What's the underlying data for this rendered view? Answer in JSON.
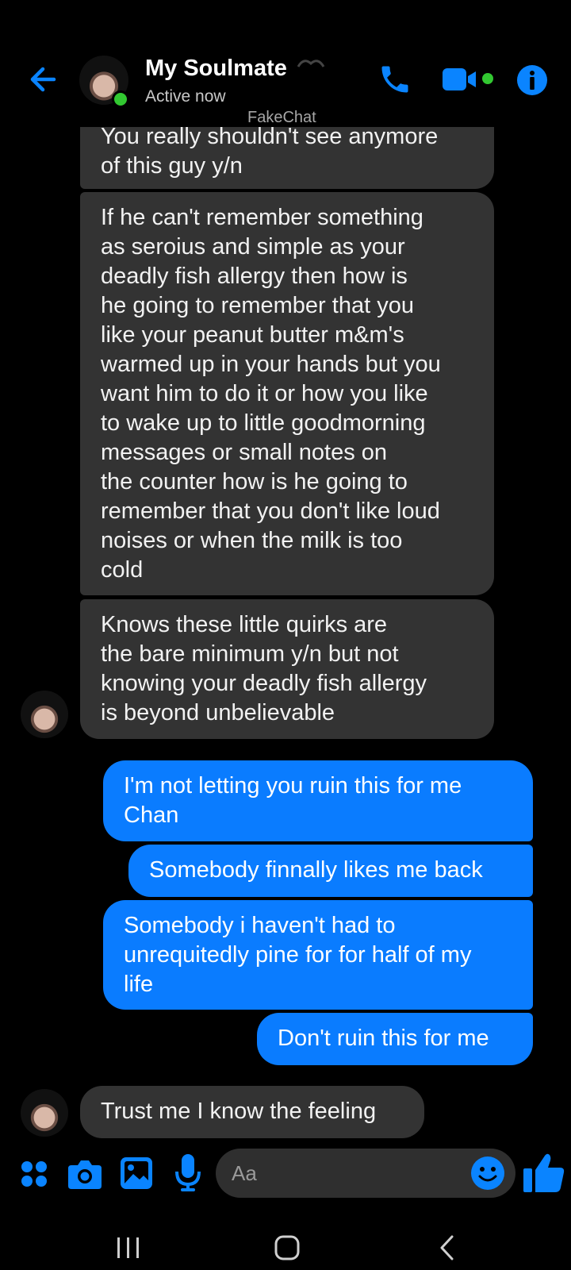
{
  "header": {
    "title": "My Soulmate",
    "status": "Active now",
    "watermark": "FakeChat"
  },
  "messages": [
    {
      "side": "in",
      "text": "You really shouldn't see anymore\nof this guy y/n"
    },
    {
      "side": "in",
      "text": "If he can't remember something\nas seroius and simple as your\ndeadly fish allergy then how is\nhe going to remember that you\nlike your peanut butter m&m's\nwarmed up in your hands but you\nwant him to do it or how you like\nto wake up to little goodmorning\nmessages or small notes on\nthe counter how is he going to\nremember that you don't like loud\nnoises or when the milk is too\ncold"
    },
    {
      "side": "in",
      "text": "Knows these little quirks are\nthe bare minimum y/n but not\nknowing your deadly fish allergy\nis beyond unbelievable"
    },
    {
      "side": "out",
      "text": "I'm not letting you ruin this for me\nChan"
    },
    {
      "side": "out",
      "text": "Somebody finnally likes me back"
    },
    {
      "side": "out",
      "text": "Somebody i haven't had to\nunrequitedly pine for for half of my\nlife"
    },
    {
      "side": "out",
      "text": "Don't ruin this for me"
    },
    {
      "side": "in",
      "text": "Trust me I know the feeling"
    }
  ],
  "composer": {
    "placeholder": "Aa"
  },
  "colors": {
    "accent": "#0a7cff",
    "incoming_bubble": "#333333",
    "online": "#32c831"
  },
  "icons": [
    "back-arrow-icon",
    "phone-icon",
    "video-icon",
    "info-icon",
    "apps-icon",
    "camera-icon",
    "gallery-icon",
    "microphone-icon",
    "emoji-icon",
    "thumbs-up-icon",
    "recents-icon",
    "home-icon",
    "nav-back-icon"
  ]
}
